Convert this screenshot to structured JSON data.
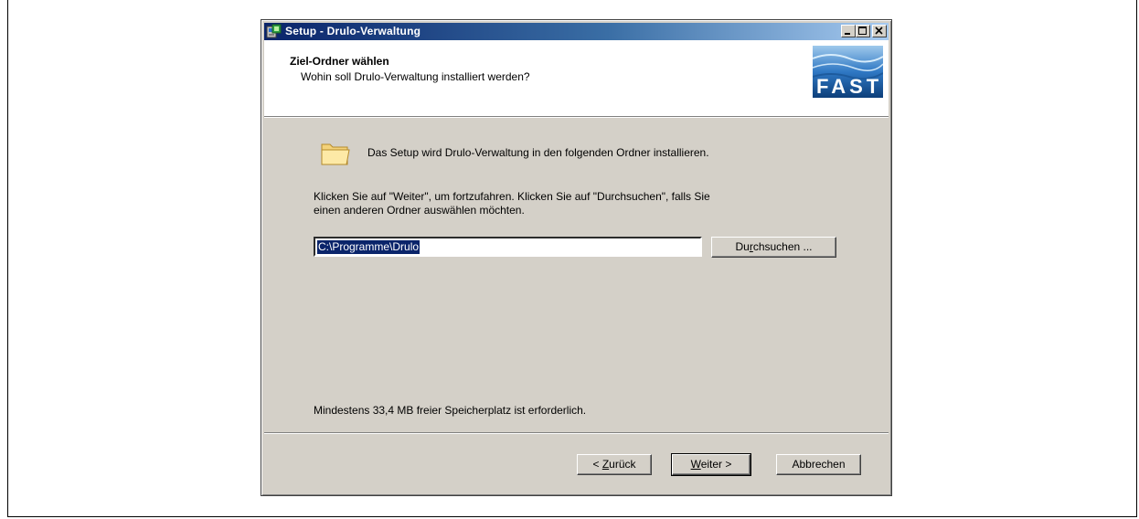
{
  "window": {
    "title": "Setup - Drulo-Verwaltung"
  },
  "header": {
    "title": "Ziel-Ordner wählen",
    "subtitle": "Wohin soll Drulo-Verwaltung installiert werden?",
    "logo_text": "FAST"
  },
  "body": {
    "intro": "Das Setup wird Drulo-Verwaltung in den folgenden Ordner installieren.",
    "instruction_line1": "Klicken Sie auf \"Weiter\", um fortzufahren. Klicken Sie auf \"Durchsuchen\", falls Sie",
    "instruction_line2": "einen anderen Ordner auswählen möchten.",
    "path_value": "C:\\Programme\\Drulo",
    "browse_pre": "Du",
    "browse_ul": "r",
    "browse_post": "chsuchen ...",
    "space_note": "Mindestens 33,4 MB freier Speicherplatz ist erforderlich."
  },
  "footer": {
    "back_pre": "< ",
    "back_ul": "Z",
    "back_post": "urück",
    "next_ul": "W",
    "next_post": "eiter >",
    "cancel_label": "Abbrechen"
  },
  "icons": [
    "setup-app-icon",
    "minimize-icon",
    "maximize-icon",
    "close-icon",
    "fast-logo",
    "folder-icon"
  ],
  "colors": {
    "titlebar_start": "#0a246a",
    "titlebar_end": "#a6caf0",
    "dialog_bg": "#d4d0c8",
    "selection": "#0a246a"
  }
}
